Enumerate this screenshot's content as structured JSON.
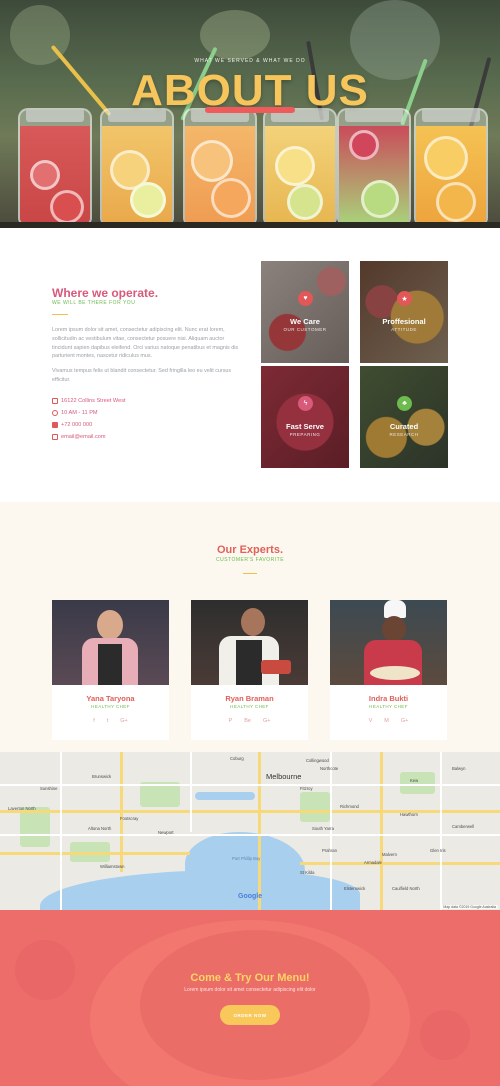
{
  "hero": {
    "subtitle": "WHAT WE SERVED & WHAT WE DO",
    "title": "ABOUT US"
  },
  "operate": {
    "title": "Where we operate.",
    "subtitle": "WE WILL BE THERE FOR YOU",
    "paragraph1": "Lorem ipsum dolor sit amet, consectetur adipiscing elit. Nunc erat lorem, sollicitudin ac vestibulum vitae, consectetur posuere nisi. Aliquam auctor tincidunt sapien dapibus eleifend. Orci varius natoque penatibus et magnis dis parturient montes, nascetur ridiculus mus.",
    "paragraph2": "Vivamus tempus felis ut blandit consectetur. Sed fringilla leo eu velit cursus efficitur.",
    "contacts": [
      {
        "icon": "phone-icon",
        "text": "16122 Collins Street West"
      },
      {
        "icon": "clock-icon",
        "text": "10 AM - 11 PM"
      },
      {
        "icon": "phone-icon",
        "text": "+72 000 000"
      },
      {
        "icon": "mail-icon",
        "text": "email@email.com"
      }
    ],
    "tiles": [
      {
        "name": "We Care",
        "sub": "OUR CUSTOMER",
        "icon": "heart-icon",
        "color": "#e25757"
      },
      {
        "name": "Proffesional",
        "sub": "ATTITUDE",
        "icon": "star-icon",
        "color": "#e25757"
      },
      {
        "name": "Fast Serve",
        "sub": "PREPARING",
        "icon": "bolt-icon",
        "color": "#d75a7a"
      },
      {
        "name": "Curated",
        "sub": "RESEARCH",
        "icon": "leaf-icon",
        "color": "#6dbb4e"
      }
    ]
  },
  "experts": {
    "title": "Our Experts.",
    "subtitle": "CUSTOMER'S FAVORITE",
    "people": [
      {
        "name": "Yana Taryona",
        "role": "HEALTHY CHEF",
        "socials": [
          "f",
          "t",
          "G+"
        ]
      },
      {
        "name": "Ryan Braman",
        "role": "HEALTHY CHEF",
        "socials": [
          "P",
          "Be",
          "G+"
        ]
      },
      {
        "name": "Indra Bukti",
        "role": "HEALTHY CHEF",
        "socials": [
          "V",
          "M",
          "G+"
        ]
      }
    ]
  },
  "map": {
    "labels": {
      "melbourne": "Melbourne",
      "brunswick": "Brunswick",
      "coburg": "Coburg",
      "northcote": "Northcote",
      "fitzroy": "Fitzroy",
      "collingwood": "Collingwood",
      "kew": "Kew",
      "balwyn": "Balwyn",
      "hawthorn": "Hawthorn",
      "camberwell": "Camberwell",
      "richmond": "Richmond",
      "south_yarra": "South Yarra",
      "prahran": "Prahran",
      "st_kilda": "St Kilda",
      "footscray": "Footscray",
      "williamstown": "Williamstown",
      "newport": "Newport",
      "altona": "Altona North",
      "laverton": "Laverton North",
      "sunshine": "Sunshine",
      "elsternwick": "Elsternwick",
      "caulfield": "Caulfield North",
      "glen_iris": "Glen Iris",
      "malvern": "Malvern",
      "armadale": "Armadale",
      "port_phillip": "Port Phillip Bay"
    },
    "google": "Google",
    "attribution": "Map data ©2019 Google   Australia"
  },
  "cta": {
    "title": "Come & Try Our Menu!",
    "text": "Lorem ipsum dolor sit amet consectetur adipiscing elit dolor",
    "button": "ORDER NOW"
  },
  "colors": {
    "accent_pink": "#d75a7a",
    "accent_green": "#6dbb4e",
    "accent_yellow": "#f1c045",
    "coral": "#ec6d6a"
  }
}
